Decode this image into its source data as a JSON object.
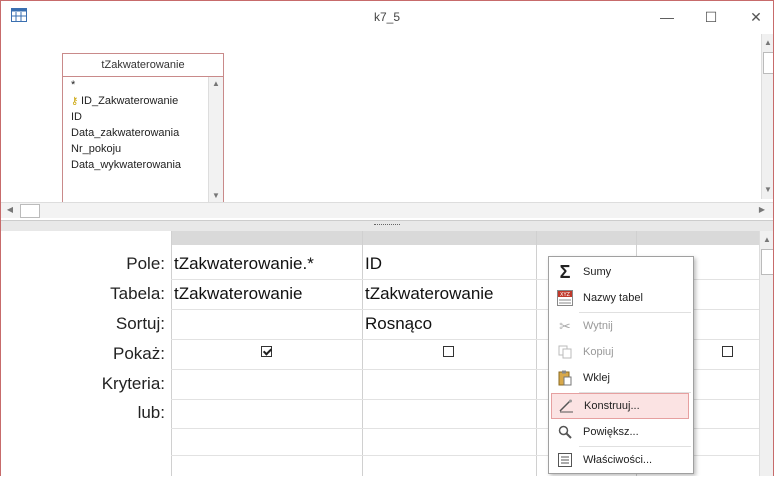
{
  "window": {
    "title": "k7_5",
    "minimize": "—",
    "maximize": "☐",
    "close": "✕"
  },
  "table_box": {
    "title": "tZakwaterowanie",
    "fields": [
      "*",
      "ID_Zakwaterowanie",
      "ID",
      "Data_zakwaterowania",
      "Nr_pokoju",
      "Data_wykwaterowania"
    ]
  },
  "grid": {
    "row_labels": [
      "Pole:",
      "Tabela:",
      "Sortuj:",
      "Pokaż:",
      "Kryteria:",
      "lub:"
    ],
    "columns": [
      {
        "pole": "tZakwaterowanie.*",
        "tabela": "tZakwaterowanie",
        "sortuj": "",
        "pokaz": true
      },
      {
        "pole": "ID",
        "tabela": "tZakwaterowanie",
        "sortuj": "Rosnąco",
        "pokaz": false
      },
      {
        "pole": "",
        "tabela": "",
        "sortuj": "",
        "pokaz": false
      },
      {
        "pole": "",
        "tabela": "",
        "sortuj": "",
        "pokaz": false
      }
    ]
  },
  "context_menu": {
    "items": [
      {
        "label": "Sumy",
        "icon": "sigma-icon",
        "enabled": true
      },
      {
        "label": "Nazwy tabel",
        "icon": "table-names-icon",
        "enabled": true
      },
      {
        "label": "Wytnij",
        "icon": "scissors-icon",
        "enabled": false
      },
      {
        "label": "Kopiuj",
        "icon": "copy-icon",
        "enabled": false
      },
      {
        "label": "Wklej",
        "icon": "paste-icon",
        "enabled": true
      },
      {
        "label": "Konstruuj...",
        "icon": "build-icon",
        "enabled": true,
        "highlighted": true
      },
      {
        "label": "Powiększ...",
        "icon": "zoom-icon",
        "enabled": true
      },
      {
        "label": "Właściwości...",
        "icon": "properties-icon",
        "enabled": true
      }
    ]
  },
  "colors": {
    "window_border": "#c76b6b",
    "menu_highlight": "#fbe3e3",
    "grid_header": "#d9d9d9"
  }
}
